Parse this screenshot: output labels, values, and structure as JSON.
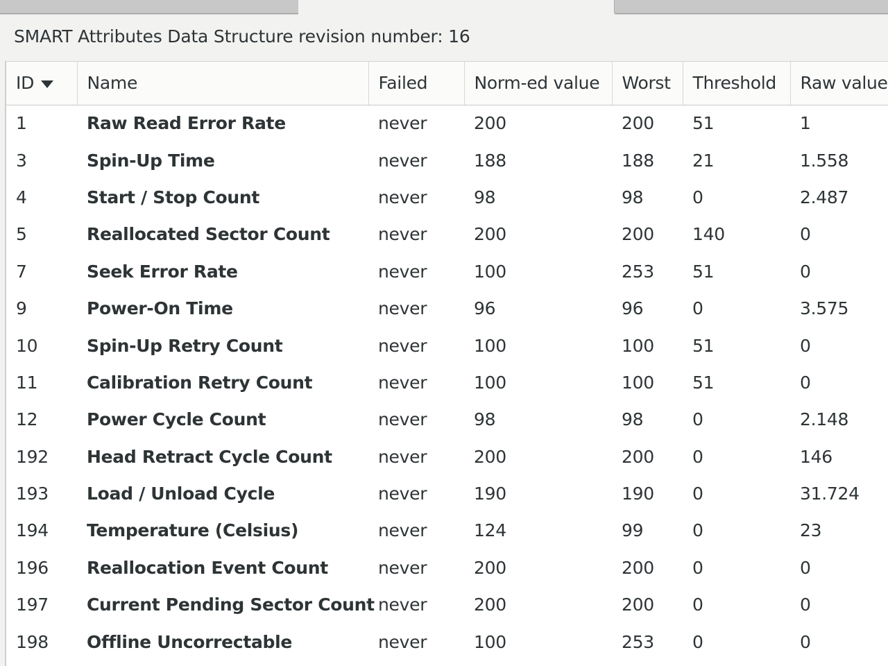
{
  "window": {
    "tabs": [
      {
        "label": "",
        "state": "inactive"
      },
      {
        "label": "",
        "state": "active"
      },
      {
        "label": "",
        "state": "inactive"
      }
    ]
  },
  "revision": {
    "text": "SMART Attributes Data Structure revision number: 16"
  },
  "table": {
    "sort_column": "ID",
    "sort_direction": "descending-arrow",
    "columns": [
      {
        "key": "id",
        "label": "ID"
      },
      {
        "key": "name",
        "label": "Name"
      },
      {
        "key": "failed",
        "label": "Failed"
      },
      {
        "key": "normed",
        "label": "Norm-ed value"
      },
      {
        "key": "worst",
        "label": "Worst"
      },
      {
        "key": "threshold",
        "label": "Threshold"
      },
      {
        "key": "raw",
        "label": "Raw value"
      }
    ],
    "rows": [
      {
        "id": "1",
        "name": "Raw Read Error Rate",
        "failed": "never",
        "normed": "200",
        "worst": "200",
        "threshold": "51",
        "raw": "1"
      },
      {
        "id": "3",
        "name": "Spin-Up Time",
        "failed": "never",
        "normed": "188",
        "worst": "188",
        "threshold": "21",
        "raw": "1.558"
      },
      {
        "id": "4",
        "name": "Start / Stop Count",
        "failed": "never",
        "normed": "98",
        "worst": "98",
        "threshold": "0",
        "raw": "2.487"
      },
      {
        "id": "5",
        "name": "Reallocated Sector Count",
        "failed": "never",
        "normed": "200",
        "worst": "200",
        "threshold": "140",
        "raw": "0"
      },
      {
        "id": "7",
        "name": "Seek Error Rate",
        "failed": "never",
        "normed": "100",
        "worst": "253",
        "threshold": "51",
        "raw": "0"
      },
      {
        "id": "9",
        "name": "Power-On Time",
        "failed": "never",
        "normed": "96",
        "worst": "96",
        "threshold": "0",
        "raw": "3.575"
      },
      {
        "id": "10",
        "name": "Spin-Up Retry Count",
        "failed": "never",
        "normed": "100",
        "worst": "100",
        "threshold": "51",
        "raw": "0"
      },
      {
        "id": "11",
        "name": "Calibration Retry Count",
        "failed": "never",
        "normed": "100",
        "worst": "100",
        "threshold": "51",
        "raw": "0"
      },
      {
        "id": "12",
        "name": "Power Cycle Count",
        "failed": "never",
        "normed": "98",
        "worst": "98",
        "threshold": "0",
        "raw": "2.148"
      },
      {
        "id": "192",
        "name": "Head Retract Cycle Count",
        "failed": "never",
        "normed": "200",
        "worst": "200",
        "threshold": "0",
        "raw": "146"
      },
      {
        "id": "193",
        "name": "Load / Unload Cycle",
        "failed": "never",
        "normed": "190",
        "worst": "190",
        "threshold": "0",
        "raw": "31.724"
      },
      {
        "id": "194",
        "name": "Temperature (Celsius)",
        "failed": "never",
        "normed": "124",
        "worst": "99",
        "threshold": "0",
        "raw": "23"
      },
      {
        "id": "196",
        "name": "Reallocation Event Count",
        "failed": "never",
        "normed": "200",
        "worst": "200",
        "threshold": "0",
        "raw": "0"
      },
      {
        "id": "197",
        "name": "Current Pending Sector Count",
        "failed": "never",
        "normed": "200",
        "worst": "200",
        "threshold": "0",
        "raw": "0"
      },
      {
        "id": "198",
        "name": "Offline Uncorrectable",
        "failed": "never",
        "normed": "100",
        "worst": "253",
        "threshold": "0",
        "raw": "0"
      }
    ]
  },
  "colors": {
    "window_background": "#f2f2f1",
    "table_background": "#ffffff",
    "header_background": "#fbfbfa",
    "text": "#2e3436",
    "border": "#d8d8d6",
    "tab_inactive": "#c8c8c8"
  }
}
